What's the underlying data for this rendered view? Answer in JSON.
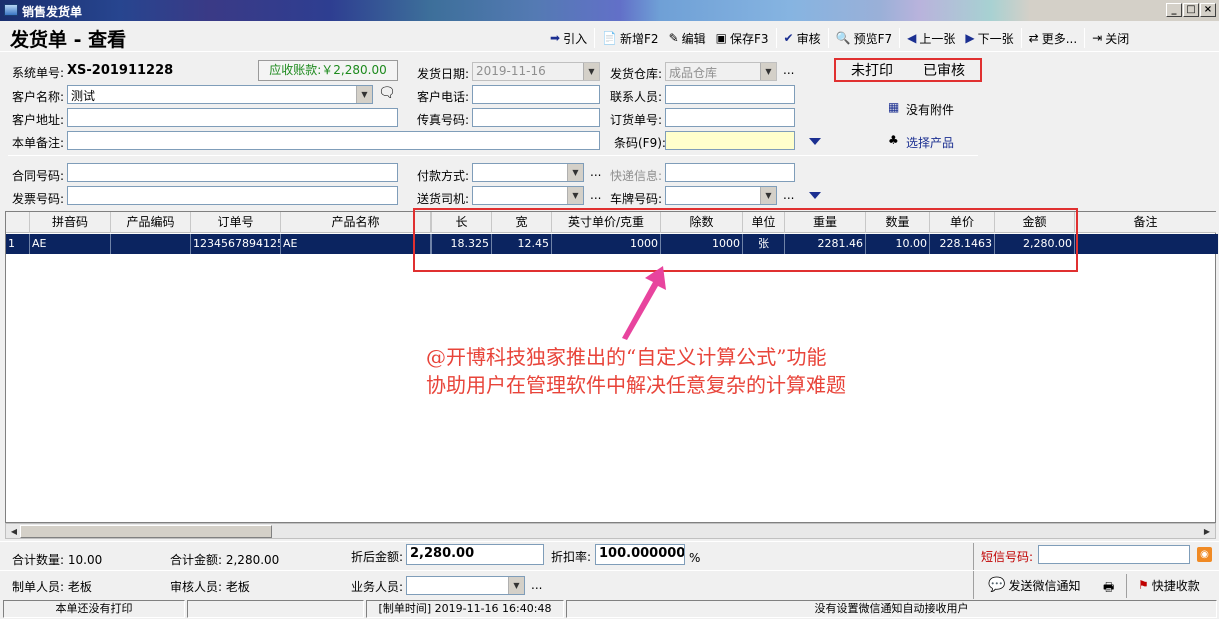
{
  "window": {
    "title": "销售发货单",
    "min": "_",
    "max": "□",
    "close": "×"
  },
  "header": {
    "doc_title": "发货单 - 查看"
  },
  "toolbar": {
    "import": "引入",
    "new": "新增F2",
    "edit": "编辑",
    "save": "保存F3",
    "audit": "审核",
    "preview": "预览F7",
    "prev": "上一张",
    "next": "下一张",
    "more": "更多...",
    "close": "关闭"
  },
  "form": {
    "sys_no_label": "系统单号:",
    "sys_no": "XS-201911228",
    "receivable": "应收账款:￥2,280.00",
    "ship_date_label": "发货日期:",
    "ship_date": "2019-11-16",
    "warehouse_label": "发货仓库:",
    "warehouse": "成品仓库",
    "customer_label": "客户名称:",
    "customer": "测试",
    "phone_label": "客户电话:",
    "phone": "",
    "contact_label": "联系人员:",
    "contact": "",
    "address_label": "客户地址:",
    "address": "",
    "fax_label": "传真号码:",
    "fax": "",
    "order_no_label": "订货单号:",
    "order_no": "",
    "remark_label": "本单备注:",
    "remark": "",
    "barcode_label": "条码(F9):",
    "barcode": "",
    "contract_label": "合同号码:",
    "contract": "",
    "payment_label": "付款方式:",
    "payment": "",
    "express_label": "快递信息:",
    "express": "",
    "invoice_label": "发票号码:",
    "invoice": "",
    "driver_label": "送货司机:",
    "driver": "",
    "plate_label": "车牌号码:",
    "plate": "",
    "dots": "..."
  },
  "status": {
    "print": "未打印",
    "audit": "已审核"
  },
  "side": {
    "attachment": "没有附件",
    "select_product": "选择产品"
  },
  "grid": {
    "headers": [
      "",
      "拼音码",
      "产品编码",
      "订单号",
      "产品名称",
      "",
      "长",
      "宽",
      "英寸单价/克重",
      "除数",
      "单位",
      "重量",
      "数量",
      "单价",
      "金额",
      "备注"
    ],
    "row": [
      "1",
      "AE",
      "",
      "12345678941253",
      "AE",
      "",
      "18.325",
      "12.45",
      "1000",
      "1000",
      "张",
      "2281.46",
      "10.00",
      "228.1463",
      "2,280.00",
      ""
    ]
  },
  "annotation": {
    "line1": "@开博科技独家推出的“自定义计算公式”功能",
    "line2": "协助用户在管理软件中解决任意复杂的计算难题"
  },
  "footer": {
    "total_qty": "合计数量: 10.00",
    "total_amount": "合计金额: 2,280.00",
    "discount_amount_label": "折后金额:",
    "discount_amount": "2,280.00",
    "discount_rate_label": "折扣率:",
    "discount_rate": "100.000000",
    "percent": "%",
    "sms_label": "短信号码:",
    "sms": "",
    "creator": "制单人员: 老板",
    "auditor": "审核人员: 老板",
    "salesman_label": "业务人员:",
    "salesman": "",
    "dots": "...",
    "wechat": "发送微信通知",
    "quick_receipt": "快捷收款"
  },
  "statusbar": {
    "print_status": "本单还没有打印",
    "blank": "",
    "created": "[制单时间] 2019-11-16 16:40:48",
    "wechat_msg": "没有设置微信通知自动接收用户"
  },
  "colors": {
    "accent": "#0b2460",
    "highlight_red": "#e03030",
    "annotation": "#e8443a",
    "receivable": "#1d8a1d"
  }
}
